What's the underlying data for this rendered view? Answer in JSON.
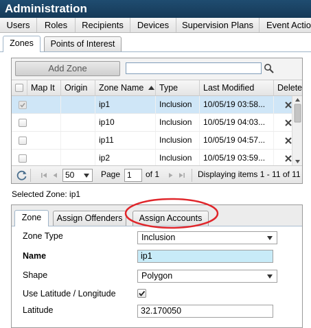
{
  "header": {
    "title": "Administration"
  },
  "top_nav": [
    "Users",
    "Roles",
    "Recipients",
    "Devices",
    "Supervision Plans",
    "Event Actions"
  ],
  "sub_tabs": [
    "Zones",
    "Points of Interest"
  ],
  "grid": {
    "add_button": "Add Zone",
    "search": {
      "value": "",
      "placeholder": ""
    },
    "columns": [
      "Map It",
      "Origin",
      "Zone Name",
      "Type",
      "Last Modified",
      "Delete"
    ],
    "rows": [
      {
        "name": "ip1",
        "type": "Inclusion",
        "modified": "10/05/19 03:58...",
        "selected": true
      },
      {
        "name": "ip10",
        "type": "Inclusion",
        "modified": "10/05/19 04:03...",
        "selected": false
      },
      {
        "name": "ip11",
        "type": "Inclusion",
        "modified": "10/05/19 04:57...",
        "selected": false
      },
      {
        "name": "ip2",
        "type": "Inclusion",
        "modified": "10/05/19 03:59...",
        "selected": false
      }
    ],
    "pager": {
      "page_size": "50",
      "page_label": "Page",
      "page_value": "1",
      "of_label": "of 1",
      "display": "Displaying items 1 - 11 of 11"
    }
  },
  "selected_zone": "Selected Zone: ip1",
  "detail": {
    "tabs": [
      "Zone",
      "Assign Offenders",
      "Assign Accounts"
    ],
    "fields": {
      "zone_type": {
        "label": "Zone Type",
        "value": "Inclusion"
      },
      "name": {
        "label": "Name",
        "value": "ip1"
      },
      "shape": {
        "label": "Shape",
        "value": "Polygon"
      },
      "use_latlon": {
        "label": "Use Latitude / Longitude",
        "checked": true
      },
      "latitude": {
        "label": "Latitude",
        "value": "32.170050"
      }
    }
  },
  "colors": {
    "header_bg": "#1b4466",
    "selected_row": "#cfe6f7",
    "annotation": "#e0262b",
    "name_field_bg": "#c8ebf8"
  }
}
